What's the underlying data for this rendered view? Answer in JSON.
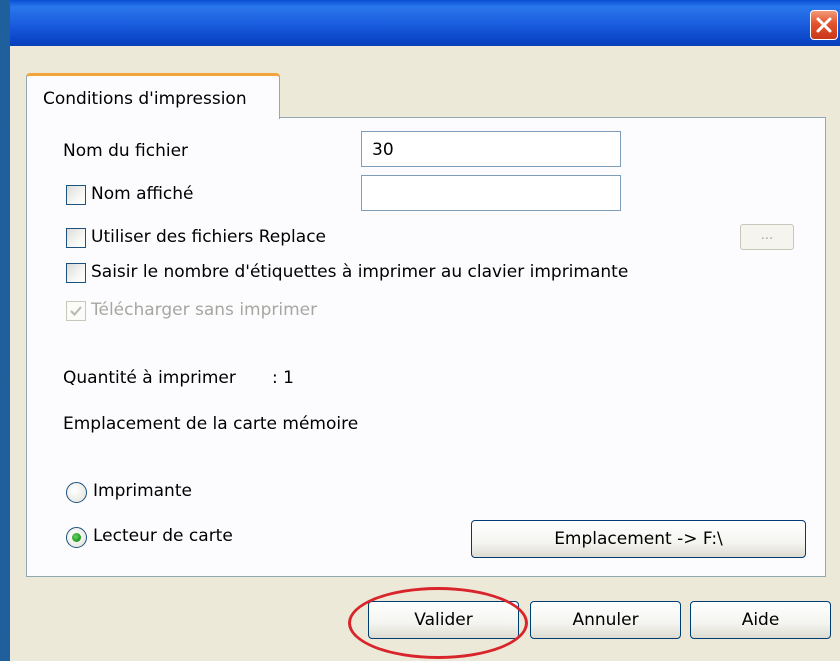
{
  "dialog": {
    "tab_label": "Conditions d'impression",
    "close_icon": "close-icon"
  },
  "form": {
    "file_name_label": "Nom du fichier",
    "file_name_value": "30",
    "display_name_label": "Nom affiché",
    "display_name_value": "",
    "display_name_checked": false,
    "use_replace_label": "Utiliser des fichiers Replace",
    "use_replace_checked": false,
    "browse_label": "...",
    "enter_count_label": "Saisir le nombre d'étiquettes à imprimer au clavier imprimante",
    "enter_count_checked": false,
    "download_only_label": "Télécharger sans imprimer",
    "download_only_checked": true,
    "download_only_enabled": false,
    "quantity_label": "Quantité à imprimer",
    "quantity_value": ": 1",
    "memory_location_label": "Emplacement de la carte mémoire",
    "radio_printer_label": "Imprimante",
    "radio_card_reader_label": "Lecteur de carte",
    "selected_location": "Lecteur de carte",
    "location_button_label": "Emplacement -> F:\\"
  },
  "footer": {
    "ok_label": "Valider",
    "cancel_label": "Annuler",
    "help_label": "Aide"
  },
  "annotation": {
    "highlight_color": "#d8242a"
  },
  "colors": {
    "titlebar": "#1c5fe0",
    "close": "#e2542c",
    "tab_accent": "#f3a53a",
    "dialog_bg": "#ece9d8"
  }
}
